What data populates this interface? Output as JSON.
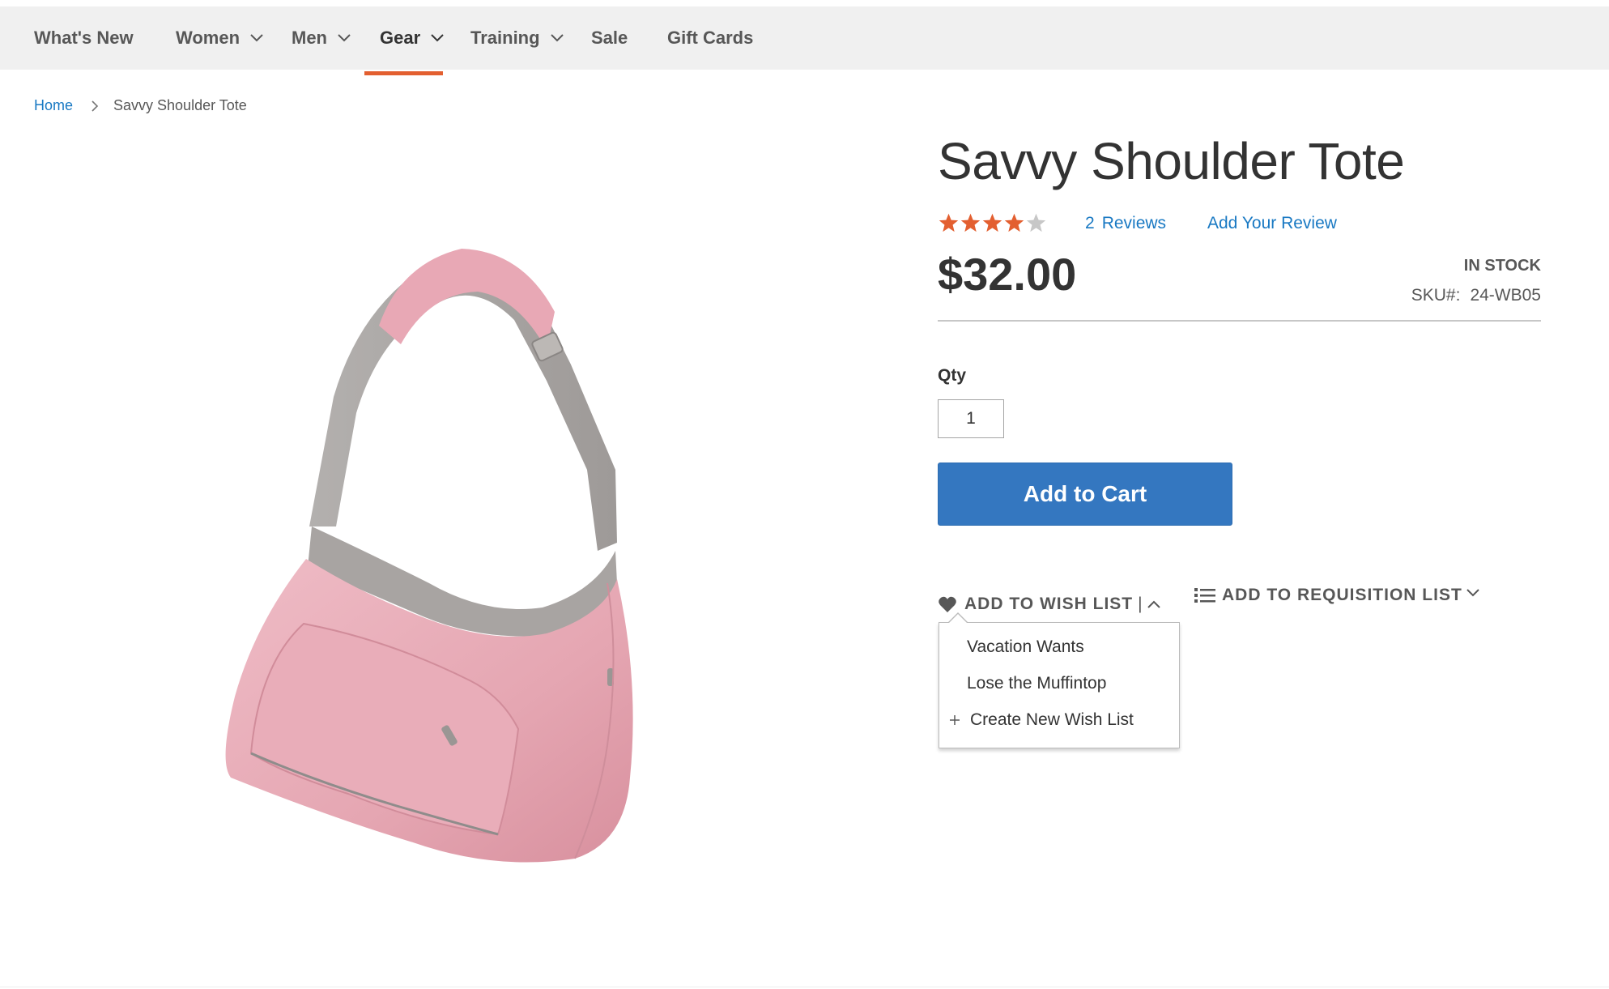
{
  "nav": {
    "items": [
      {
        "label": "What's New",
        "has_dropdown": false
      },
      {
        "label": "Women",
        "has_dropdown": true
      },
      {
        "label": "Men",
        "has_dropdown": true
      },
      {
        "label": "Gear",
        "has_dropdown": true,
        "active": true
      },
      {
        "label": "Training",
        "has_dropdown": true
      },
      {
        "label": "Sale",
        "has_dropdown": false
      },
      {
        "label": "Gift Cards",
        "has_dropdown": false
      }
    ],
    "active_underline_color": "#e35f30"
  },
  "breadcrumb": {
    "home": "Home",
    "current": "Savvy Shoulder Tote"
  },
  "product": {
    "title": "Savvy Shoulder Tote",
    "rating": {
      "value": 4,
      "max": 5,
      "filled_color": "#e35f30",
      "empty_color": "#c7c7c7"
    },
    "reviews_count": "2",
    "reviews_label": "Reviews",
    "add_review_label": "Add Your Review",
    "price": "$32.00",
    "stock_status": "In stock",
    "sku_label": "SKU#:",
    "sku_value": "24-WB05",
    "image_icon": "pink-shoulder-tote-image",
    "image_color": "#e8aab5"
  },
  "form": {
    "qty_label": "Qty",
    "qty_value": "1",
    "add_to_cart_label": "Add to Cart",
    "add_to_cart_color": "#3477c0"
  },
  "actions": {
    "wish_list_label": "Add to Wish List",
    "wish_list_icon": "heart-icon",
    "requisition_label": "Add to Requisition List",
    "requisition_icon": "list-icon"
  },
  "wish_dropdown": {
    "options": [
      "Vacation Wants",
      "Lose the Muffintop"
    ],
    "create_label": "Create New Wish List"
  },
  "colors": {
    "link": "#1979c3",
    "nav_bg": "#f0f0f0"
  }
}
